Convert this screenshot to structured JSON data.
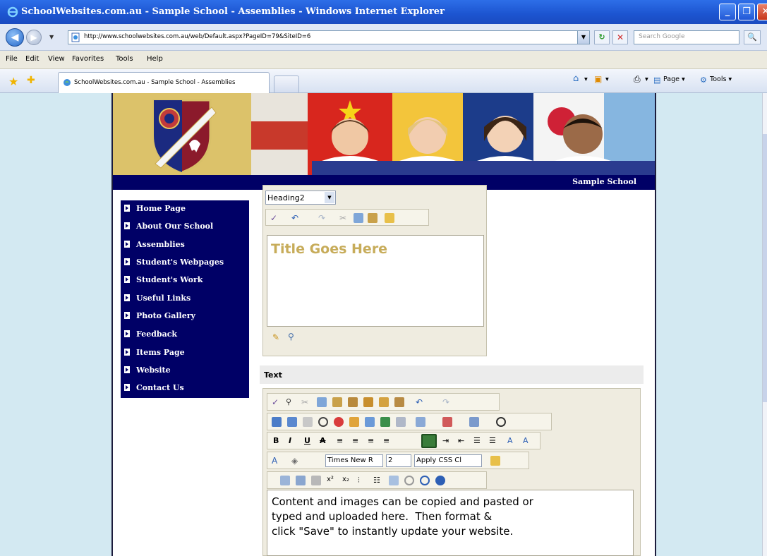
{
  "window": {
    "title": "SchoolWebsites.com.au - Sample School - Assemblies - Windows Internet Explorer",
    "minimize": "_",
    "maximize": "❐",
    "close": "✕"
  },
  "address_bar": {
    "url": "http://www.schoolwebsites.com.au/web/Default.aspx?PageID=79&SiteID=6",
    "search_placeholder": "Search Google"
  },
  "menu": {
    "items": [
      "File",
      "Edit",
      "View",
      "Favorites",
      "Tools",
      "Help"
    ]
  },
  "tab": {
    "label": "SchoolWebsites.com.au - Sample School - Assemblies"
  },
  "commands": {
    "home": "▾",
    "feeds": "▾",
    "print": "▾",
    "page": "Page ▾",
    "tools": "Tools ▾"
  },
  "site": {
    "name": "Sample School",
    "nav": [
      "Home Page",
      "About Our School",
      "Assemblies",
      "Student's Webpages",
      "Student's Work",
      "Useful Links",
      "Photo Gallery",
      "Feedback",
      "Items Page",
      "Website",
      "Contact Us"
    ]
  },
  "editor": {
    "style_value": "Heading2",
    "title_text": "Title Goes Here",
    "text_label": "Text",
    "font_name": "Times New R",
    "font_size": "2",
    "css_class": "Apply CSS Cl",
    "content": "Content and images can be copied and pasted or\ntyped and uploaded here.  Then format &\nclick \"Save\" to instantly update your website."
  }
}
